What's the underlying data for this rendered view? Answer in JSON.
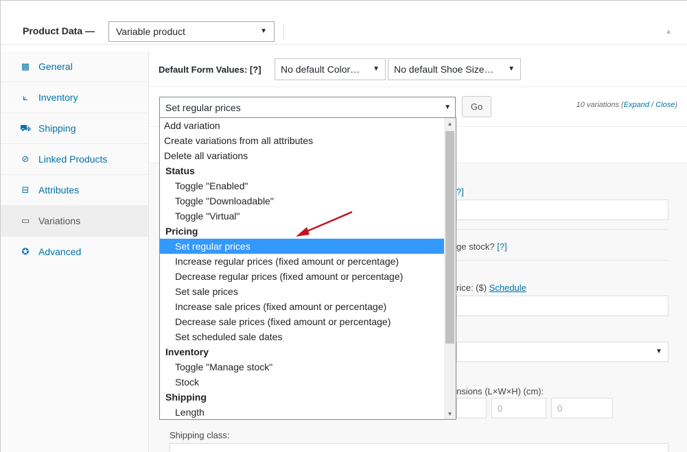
{
  "header": {
    "title": "Product Data —",
    "product_type": "Variable product"
  },
  "sidebar": {
    "items": [
      {
        "label": "General",
        "icon": "table-icon"
      },
      {
        "label": "Inventory",
        "icon": "chart-icon"
      },
      {
        "label": "Shipping",
        "icon": "truck-icon"
      },
      {
        "label": "Linked Products",
        "icon": "link-icon"
      },
      {
        "label": "Attributes",
        "icon": "list-icon"
      },
      {
        "label": "Variations",
        "icon": "window-icon"
      },
      {
        "label": "Advanced",
        "icon": "gear-icon"
      }
    ],
    "active": "Variations"
  },
  "default_form": {
    "label": "Default Form Values: [?]",
    "color": "No default Color…",
    "shoe_size": "No default Shoe Size…"
  },
  "bulk": {
    "selected": "Set regular prices",
    "go_label": "Go",
    "count_text": "10 variations (",
    "expand_close": "Expand / Close",
    "count_close": ")"
  },
  "background_fields": {
    "help_fragment": "?]",
    "manage_stock": "ge stock?",
    "help": "[?]",
    "price_label": "rice: ($)",
    "schedule": "Schedule",
    "dimensions": "nsions (L×W×H) (cm):",
    "dim_w": "0",
    "dim_h": "0",
    "shipping_class": "Shipping class:"
  },
  "dropdown": {
    "options": [
      {
        "text": "Add variation",
        "kind": "top"
      },
      {
        "text": "Create variations from all attributes",
        "kind": "top"
      },
      {
        "text": "Delete all variations",
        "kind": "top"
      },
      {
        "text": "Status",
        "kind": "grp"
      },
      {
        "text": "Toggle \"Enabled\"",
        "kind": "sub"
      },
      {
        "text": "Toggle \"Downloadable\"",
        "kind": "sub"
      },
      {
        "text": "Toggle \"Virtual\"",
        "kind": "sub"
      },
      {
        "text": "Pricing",
        "kind": "grp"
      },
      {
        "text": "Set regular prices",
        "kind": "selected"
      },
      {
        "text": "Increase regular prices (fixed amount or percentage)",
        "kind": "sub"
      },
      {
        "text": "Decrease regular prices (fixed amount or percentage)",
        "kind": "sub"
      },
      {
        "text": "Set sale prices",
        "kind": "sub"
      },
      {
        "text": "Increase sale prices (fixed amount or percentage)",
        "kind": "sub"
      },
      {
        "text": "Decrease sale prices (fixed amount or percentage)",
        "kind": "sub"
      },
      {
        "text": "Set scheduled sale dates",
        "kind": "sub"
      },
      {
        "text": "Inventory",
        "kind": "grp"
      },
      {
        "text": "Toggle \"Manage stock\"",
        "kind": "sub"
      },
      {
        "text": "Stock",
        "kind": "sub"
      },
      {
        "text": "Shipping",
        "kind": "grp"
      },
      {
        "text": "Length",
        "kind": "sub"
      }
    ]
  },
  "colors": {
    "accent": "#0073aa",
    "highlight": "#3399ff",
    "arrow": "#c0141c"
  }
}
